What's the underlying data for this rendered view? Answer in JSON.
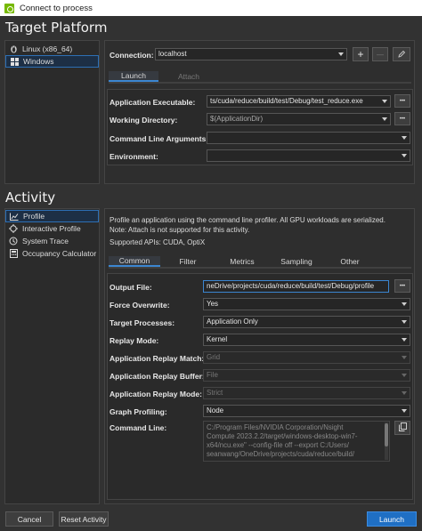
{
  "window": {
    "title": "Connect to process"
  },
  "target_platform": {
    "title": "Target Platform",
    "platforms": [
      {
        "label": "Linux (x86_64)",
        "icon": "linux-icon",
        "selected": false
      },
      {
        "label": "Windows",
        "icon": "windows-icon",
        "selected": true
      }
    ],
    "connection_label": "Connection:",
    "connection_value": "localhost",
    "tabs": [
      {
        "label": "Launch",
        "active": true
      },
      {
        "label": "Attach",
        "active": false
      }
    ],
    "fields": [
      {
        "label": "Application Executable:",
        "value": "ts/cuda/reduce/build/test/Debug/test_reduce.exe"
      },
      {
        "label": "Working Directory:",
        "value": "$(ApplicationDir)"
      },
      {
        "label": "Command Line Arguments:",
        "value": ""
      },
      {
        "label": "Environment:",
        "value": ""
      }
    ]
  },
  "activity": {
    "title": "Activity",
    "items": [
      {
        "label": "Profile",
        "icon": "profile-chart-icon",
        "selected": true
      },
      {
        "label": "Interactive Profile",
        "icon": "interactive-profile-icon",
        "selected": false
      },
      {
        "label": "System Trace",
        "icon": "system-trace-icon",
        "selected": false
      },
      {
        "label": "Occupancy Calculator",
        "icon": "calculator-icon",
        "selected": false
      }
    ],
    "description": {
      "line1": "Profile an application using the command line profiler. All GPU workloads are serialized.",
      "line2": "Note: Attach is not supported for this activity.",
      "line3": "Supported APIs: CUDA, OptiX"
    },
    "tabs": [
      {
        "label": "Common",
        "active": true
      },
      {
        "label": "Filter",
        "active": false
      },
      {
        "label": "Metrics",
        "active": false
      },
      {
        "label": "Sampling",
        "active": false
      },
      {
        "label": "Other",
        "active": false
      }
    ],
    "settings": [
      {
        "label": "Output File:",
        "value": "neDrive/projects/cuda/reduce/build/test/Debug/profile"
      },
      {
        "label": "Force Overwrite:",
        "value": "Yes"
      },
      {
        "label": "Target Processes:",
        "value": "Application Only"
      },
      {
        "label": "Replay Mode:",
        "value": "Kernel"
      },
      {
        "label": "Application Replay Match:",
        "value": "Grid"
      },
      {
        "label": "Application Replay Buffer:",
        "value": "File"
      },
      {
        "label": "Application Replay Mode:",
        "value": "Strict"
      },
      {
        "label": "Graph Profiling:",
        "value": "Node"
      }
    ],
    "command_line_label": "Command Line:",
    "command_line_lines": [
      "C:/Program Files/NVIDIA Corporation/Nsight",
      "Compute 2023.2.2/target/windows-desktop-win7-",
      "x64/ncu.exe\" --config-file off --export C:/Users/",
      "seanwang/OneDrive/projects/cuda/reduce/build/"
    ]
  },
  "footer": {
    "cancel": "Cancel",
    "reset": "Reset Activity",
    "launch": "Launch"
  },
  "buttons": {
    "ellipsis": "•••",
    "add": "+",
    "remove": "—"
  },
  "colors": {
    "accent": "#1f6fc4",
    "selection": "#2d6fb5",
    "nvidia_green": "#76b900",
    "background": "#323232"
  }
}
